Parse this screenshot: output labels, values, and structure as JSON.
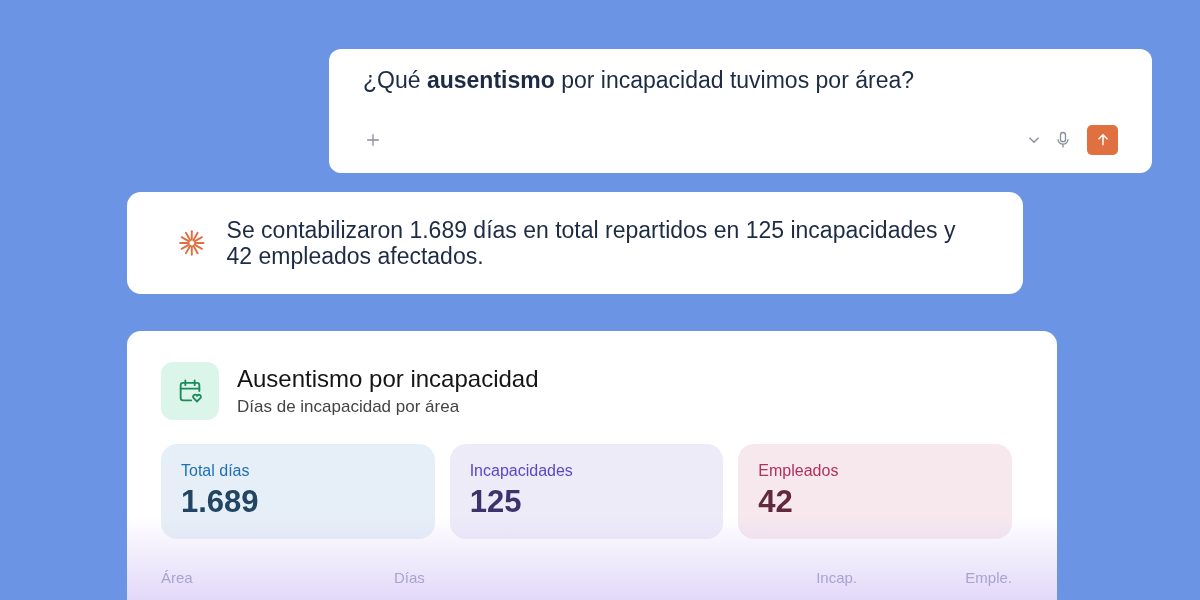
{
  "prompt": {
    "text": "¿Qué **ausentismo** por incapacidad tuvimos por área?"
  },
  "answer": {
    "text": "Se contabilizaron 1.689 días en total repartidos en 125 incapacidades y 42 empleados afectados."
  },
  "card": {
    "title": "Ausentismo por incapacidad",
    "subtitle": "Días de incapacidad por área",
    "stats": [
      {
        "label": "Total días",
        "value": "1.689",
        "color": "#1f6fb2"
      },
      {
        "label": "Incapacidades",
        "value": "125",
        "color": "#5a48c2"
      },
      {
        "label": "Empleados",
        "value": "42",
        "color": "#b0305e"
      }
    ],
    "table": {
      "columns": [
        "Área",
        "Días",
        "Incap.",
        "Emple."
      ]
    }
  }
}
